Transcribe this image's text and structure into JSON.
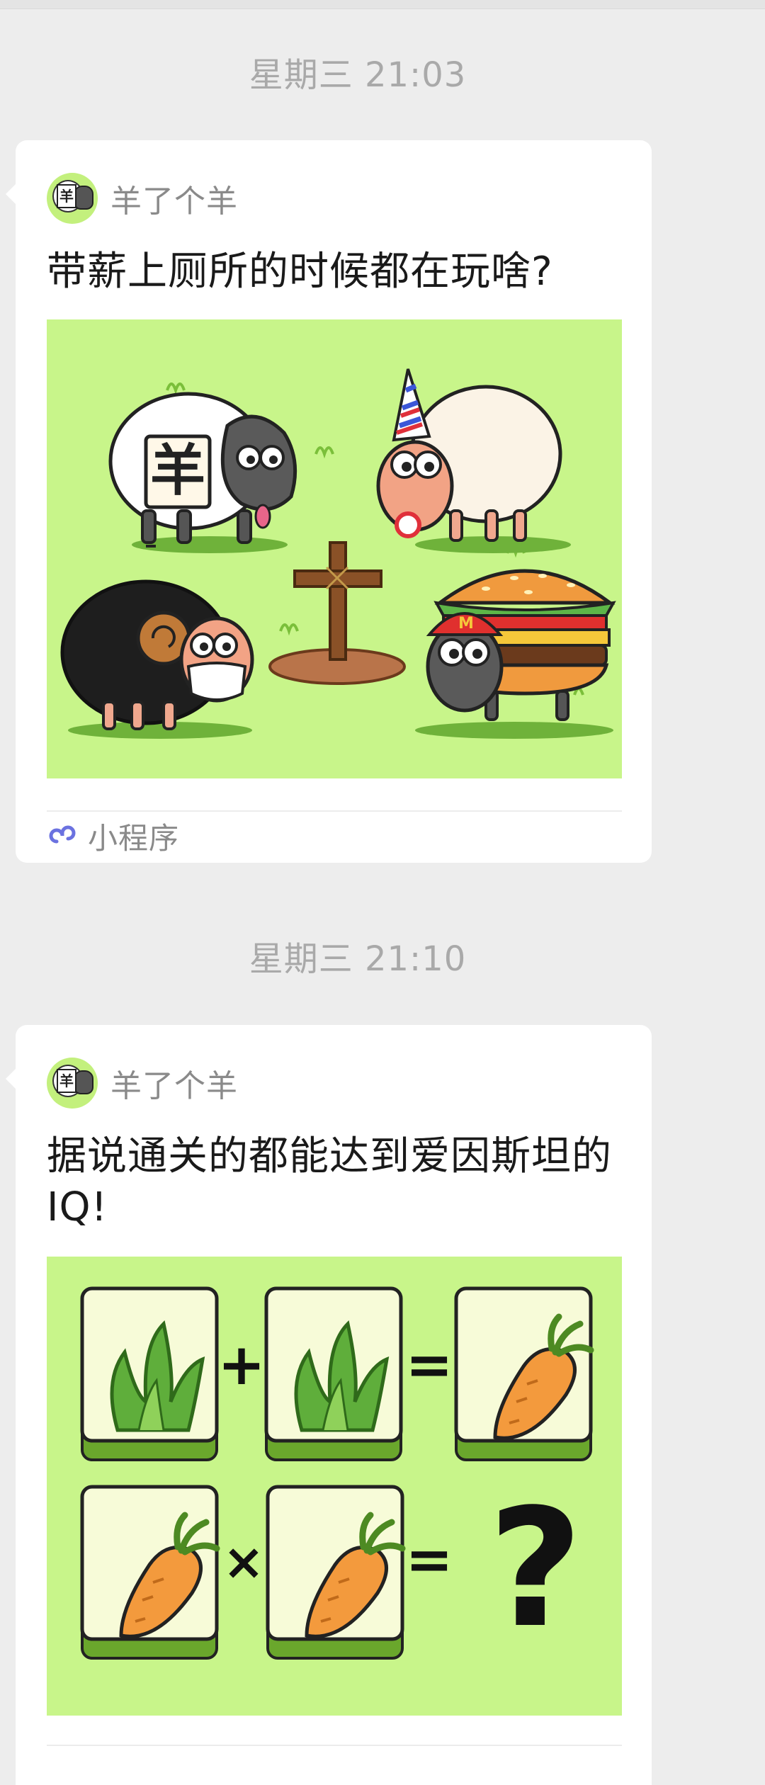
{
  "messages": [
    {
      "timestamp": "星期三 21:03",
      "app_name": "羊了个羊",
      "title": "带薪上厕所的时候都在玩啥?",
      "footer_label": "小程序",
      "thumbnail_text": "羊"
    },
    {
      "timestamp": "星期三 21:10",
      "app_name": "羊了个羊",
      "title": "据说通关的都能达到爱因斯坦的IQ!",
      "puzzle": {
        "row1_ops": [
          "+",
          "="
        ],
        "row2_ops": [
          "×",
          "="
        ],
        "answer": "?"
      }
    }
  ],
  "colors": {
    "background": "#ededed",
    "card": "#ffffff",
    "thumbnail_green": "#c8f58a",
    "timestamp_text": "#a9a9a9",
    "mini_program_icon": "#6b72e0"
  },
  "icons": {
    "mini_program": "mini-program-link-icon",
    "avatar": "sheep-game-avatar"
  }
}
